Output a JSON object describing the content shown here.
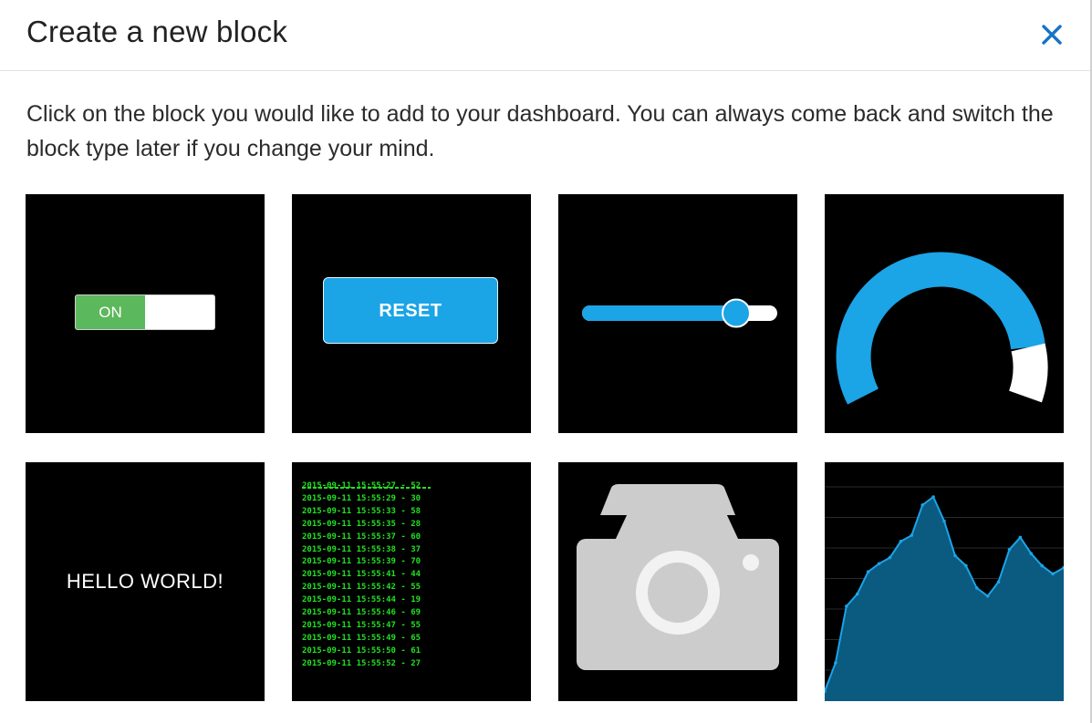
{
  "dialog": {
    "title": "Create a new block",
    "close_icon": "close-icon",
    "intro": "Click on the block you would like to add to your dashboard. You can always come back and switch the block type later if you change your mind.",
    "accent_color": "#1ba4e6"
  },
  "blocks": {
    "switch": {
      "icon": "switch-icon",
      "on_label": "ON",
      "on_color": "#5cb85c",
      "state": "on"
    },
    "button": {
      "icon": "button-icon",
      "label": "RESET",
      "color": "#1ba4e6"
    },
    "slider": {
      "icon": "slider-icon",
      "value_fraction": 0.79
    },
    "gauge": {
      "icon": "gauge-icon",
      "value_fraction": 0.85
    },
    "text": {
      "icon": "text-icon",
      "label": "HELLO WORLD!"
    },
    "log": {
      "icon": "log-icon",
      "lines": [
        "2015-09-11 15:55:27 - 52",
        "2015-09-11 15:55:29 - 30",
        "2015-09-11 15:55:33 - 58",
        "2015-09-11 15:55:35 - 28",
        "2015-09-11 15:55:37 - 60",
        "2015-09-11 15:55:38 - 37",
        "2015-09-11 15:55:39 - 70",
        "2015-09-11 15:55:41 - 44",
        "2015-09-11 15:55:42 - 55",
        "2015-09-11 15:55:44 - 19",
        "2015-09-11 15:55:46 - 69",
        "2015-09-11 15:55:47 - 55",
        "2015-09-11 15:55:49 - 65",
        "2015-09-11 15:55:50 - 61",
        "2015-09-11 15:55:52 - 27"
      ]
    },
    "camera": {
      "icon": "camera-icon"
    },
    "chart": {
      "icon": "area-chart-icon",
      "values": [
        4,
        18,
        46,
        52,
        63,
        67,
        70,
        78,
        81,
        96,
        100,
        88,
        71,
        66,
        55,
        51,
        58,
        74,
        80,
        72,
        66,
        62,
        65
      ]
    }
  }
}
